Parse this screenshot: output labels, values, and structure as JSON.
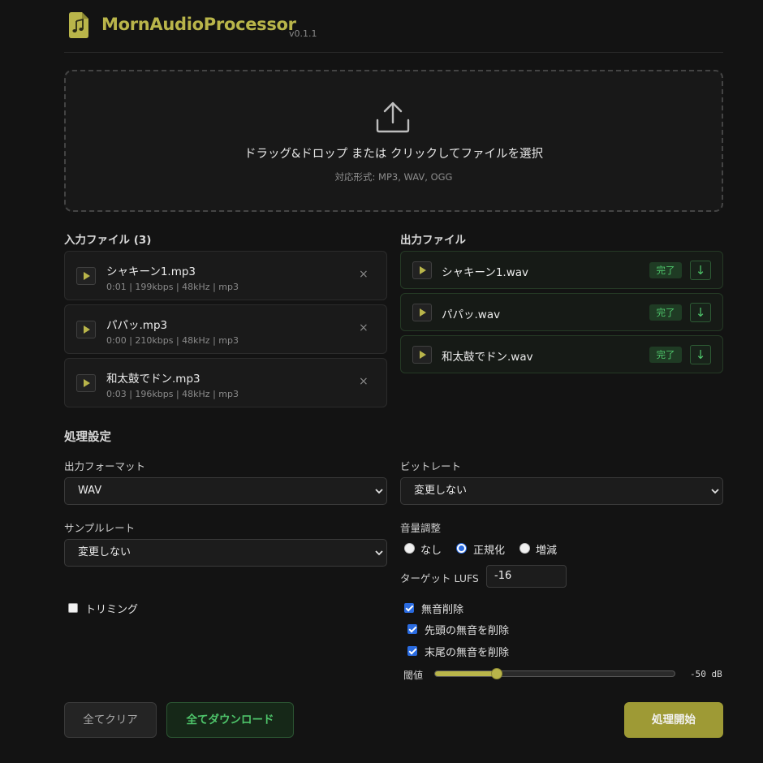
{
  "header": {
    "title": "MornAudioProcessor",
    "version": "v0.1.1"
  },
  "dropzone": {
    "main": "ドラッグ&ドロップ または クリックしてファイルを選択",
    "sub": "対応形式: MP3, WAV, OGG"
  },
  "input_files": {
    "heading": "入力ファイル (3)",
    "items": [
      {
        "name": "シャキーン1.mp3",
        "meta": "0:01 | 199kbps | 48kHz | mp3",
        "remove": "×"
      },
      {
        "name": "パパッ.mp3",
        "meta": "0:00 | 210kbps | 48kHz | mp3",
        "remove": "×"
      },
      {
        "name": "和太鼓でドン.mp3",
        "meta": "0:03 | 196kbps | 48kHz | mp3",
        "remove": "×"
      }
    ]
  },
  "output_files": {
    "heading": "出力ファイル",
    "items": [
      {
        "name": "シャキーン1.wav",
        "status": "完了",
        "download": "↓"
      },
      {
        "name": "パパッ.wav",
        "status": "完了",
        "download": "↓"
      },
      {
        "name": "和太鼓でドン.wav",
        "status": "完了",
        "download": "↓"
      }
    ]
  },
  "settings": {
    "heading": "処理設定",
    "output_format": {
      "label": "出力フォーマット",
      "value": "WAV"
    },
    "bitrate": {
      "label": "ビットレート",
      "value": "変更しない"
    },
    "sample_rate": {
      "label": "サンプルレート",
      "value": "変更しない"
    },
    "volume": {
      "label": "音量調整",
      "options": [
        "なし",
        "正規化",
        "増減"
      ],
      "selected": "正規化",
      "target_label": "ターゲット LUFS",
      "target_value": "-16"
    },
    "trimming": {
      "label": "トリミング",
      "checked": false
    },
    "silence": {
      "label": "無音削除",
      "checked": true,
      "leading": {
        "label": "先頭の無音を削除",
        "checked": true
      },
      "trailing": {
        "label": "末尾の無音を削除",
        "checked": true
      },
      "threshold": {
        "label": "閾値",
        "value_text": "-50 dB",
        "fraction": 0.26
      }
    }
  },
  "actions": {
    "clear": "全てクリア",
    "download_all": "全てダウンロード",
    "start": "処理開始"
  },
  "colors": {
    "accent": "#b9b54a",
    "success": "#4ec46a",
    "background": "#131313",
    "checkbox": "#2a6be0"
  },
  "icons": {
    "logo": "music-file-icon",
    "upload": "upload-icon",
    "play": "play-icon",
    "remove": "close-icon",
    "download": "download-icon",
    "select": "chevron-down-icon"
  }
}
